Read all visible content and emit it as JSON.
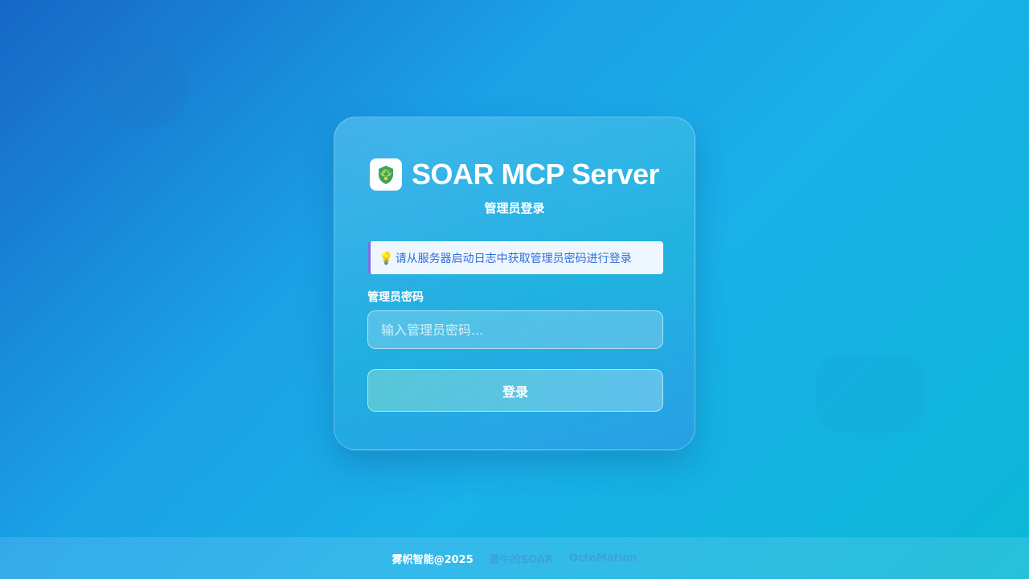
{
  "app": {
    "title": "SOAR MCP Server",
    "subtitle": "管理员登录",
    "logo_icon": "shield-plant-icon"
  },
  "login": {
    "hint_icon": "lightbulb-icon",
    "hint_text": "请从服务器启动日志中获取管理员密码进行登录",
    "password_label": "管理员密码",
    "password_placeholder": "输入管理员密码...",
    "password_value": "",
    "submit_label": "登录"
  },
  "footer": {
    "copyright": "雾帜智能@2025",
    "links": [
      "最牛的SOAR",
      "OctoMation"
    ]
  },
  "colors": {
    "background_start": "#1767c6",
    "background_end": "#0ab8d6",
    "hint_text": "#2f6fd8",
    "hint_border": "#7c6ee0"
  }
}
